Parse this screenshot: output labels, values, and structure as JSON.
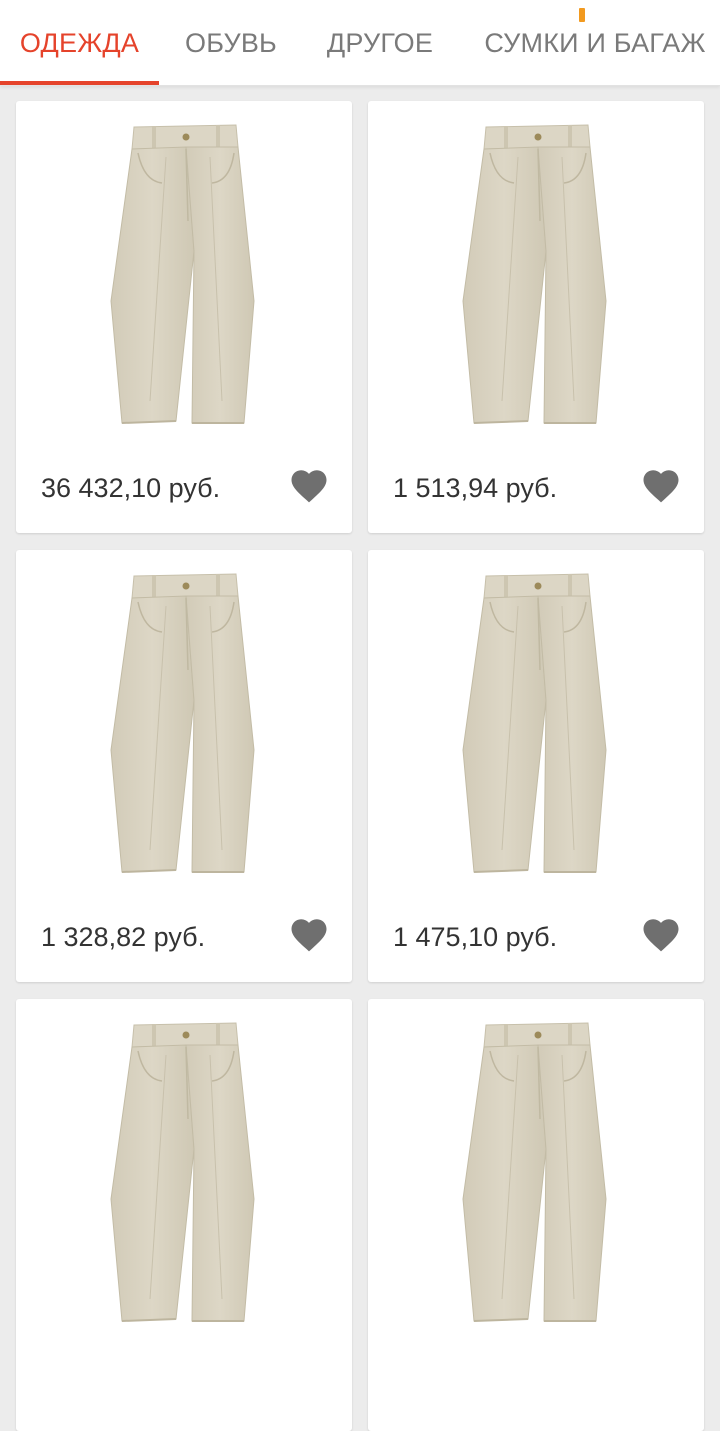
{
  "tabs": [
    {
      "label": "ОДЕЖДА",
      "active": true
    },
    {
      "label": "ОБУВЬ",
      "active": false
    },
    {
      "label": "ДРУГОЕ",
      "active": false
    },
    {
      "label": "СУМКИ И БАГАЖ",
      "active": false
    }
  ],
  "accent_color": "#e5432b",
  "products": [
    {
      "price": "36 432,10 руб.",
      "image": "beige-trousers",
      "favorite_icon": "heart-icon"
    },
    {
      "price": "1 513,94 руб.",
      "image": "beige-trousers",
      "favorite_icon": "heart-icon"
    },
    {
      "price": "1 328,82 руб.",
      "image": "beige-trousers",
      "favorite_icon": "heart-icon"
    },
    {
      "price": "1 475,10 руб.",
      "image": "beige-trousers",
      "favorite_icon": "heart-icon"
    },
    {
      "price": "",
      "image": "beige-trousers",
      "favorite_icon": "heart-icon"
    },
    {
      "price": "",
      "image": "beige-trousers",
      "favorite_icon": "heart-icon"
    }
  ]
}
